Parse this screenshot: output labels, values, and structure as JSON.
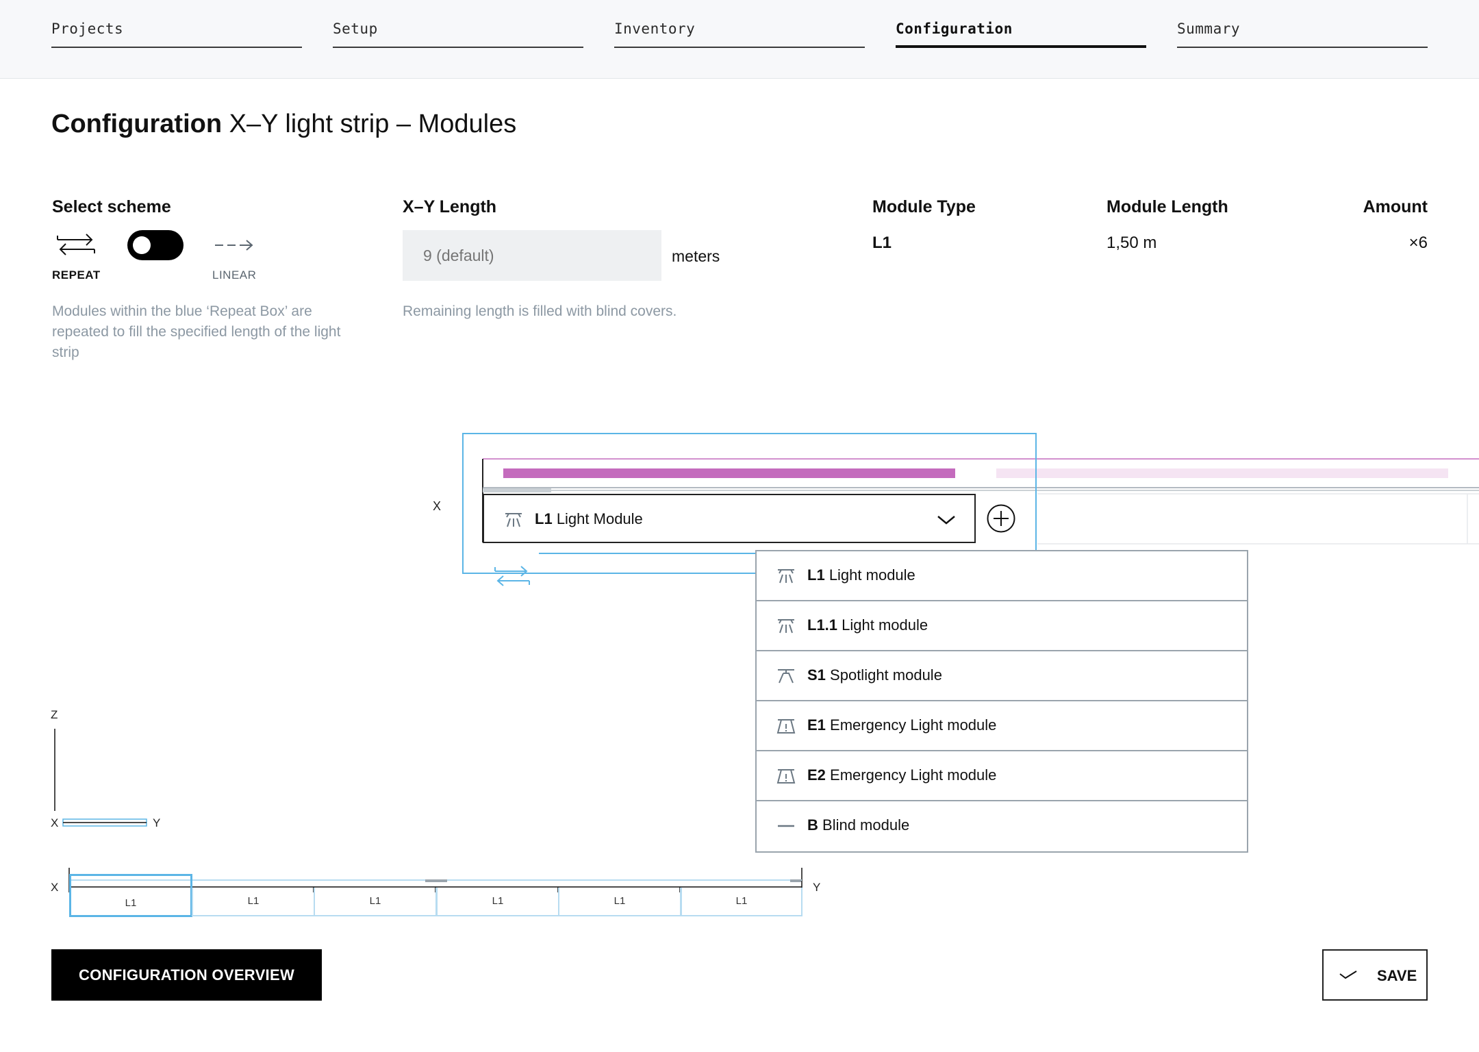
{
  "nav": {
    "steps": [
      "Projects",
      "Setup",
      "Inventory",
      "Configuration",
      "Summary"
    ],
    "active": "Configuration"
  },
  "title": {
    "bold": "Configuration",
    "rest": "X–Y light strip – Modules"
  },
  "scheme": {
    "heading": "Select scheme",
    "repeat_label": "REPEAT",
    "linear_label": "LINEAR",
    "toggle_state": "repeat",
    "help": "Modules within the blue ‘Repeat Box’ are repeated to fill the specified length of the light strip"
  },
  "length": {
    "heading": "X–Y Length",
    "placeholder": "9 (default)",
    "unit": "meters",
    "help": "Remaining length is filled with blind covers."
  },
  "summary": {
    "type_heading": "Module Type",
    "length_heading": "Module Length",
    "amount_heading": "Amount",
    "type_value": "L1",
    "length_value": "1,50 m",
    "amount_value": "×6"
  },
  "diagram": {
    "axis_x": "X",
    "axis_y": "Y",
    "axis_z": "Z",
    "selected_code": "L1",
    "selected_name": "Light Module",
    "colors": {
      "accent_blue": "#5bb5e6",
      "magenta": "#c46bbd",
      "magenta_light": "#f5e4f3"
    }
  },
  "menu": {
    "options": [
      {
        "code": "L1",
        "name": "Light module",
        "icon": "light-icon"
      },
      {
        "code": "L1.1",
        "name": "Light module",
        "icon": "light-icon"
      },
      {
        "code": "S1",
        "name": "Spotlight module",
        "icon": "spotlight-icon"
      },
      {
        "code": "E1",
        "name": "Emergency Light module",
        "icon": "emergency-icon"
      },
      {
        "code": "E2",
        "name": "Emergency Light module",
        "icon": "emergency-icon"
      },
      {
        "code": "B",
        "name": "Blind module",
        "icon": "blind-icon"
      }
    ]
  },
  "strip": {
    "cells": [
      "L1",
      "L1",
      "L1",
      "L1",
      "L1",
      "L1"
    ]
  },
  "buttons": {
    "overview": "CONFIGURATION OVERVIEW",
    "save": "SAVE"
  }
}
